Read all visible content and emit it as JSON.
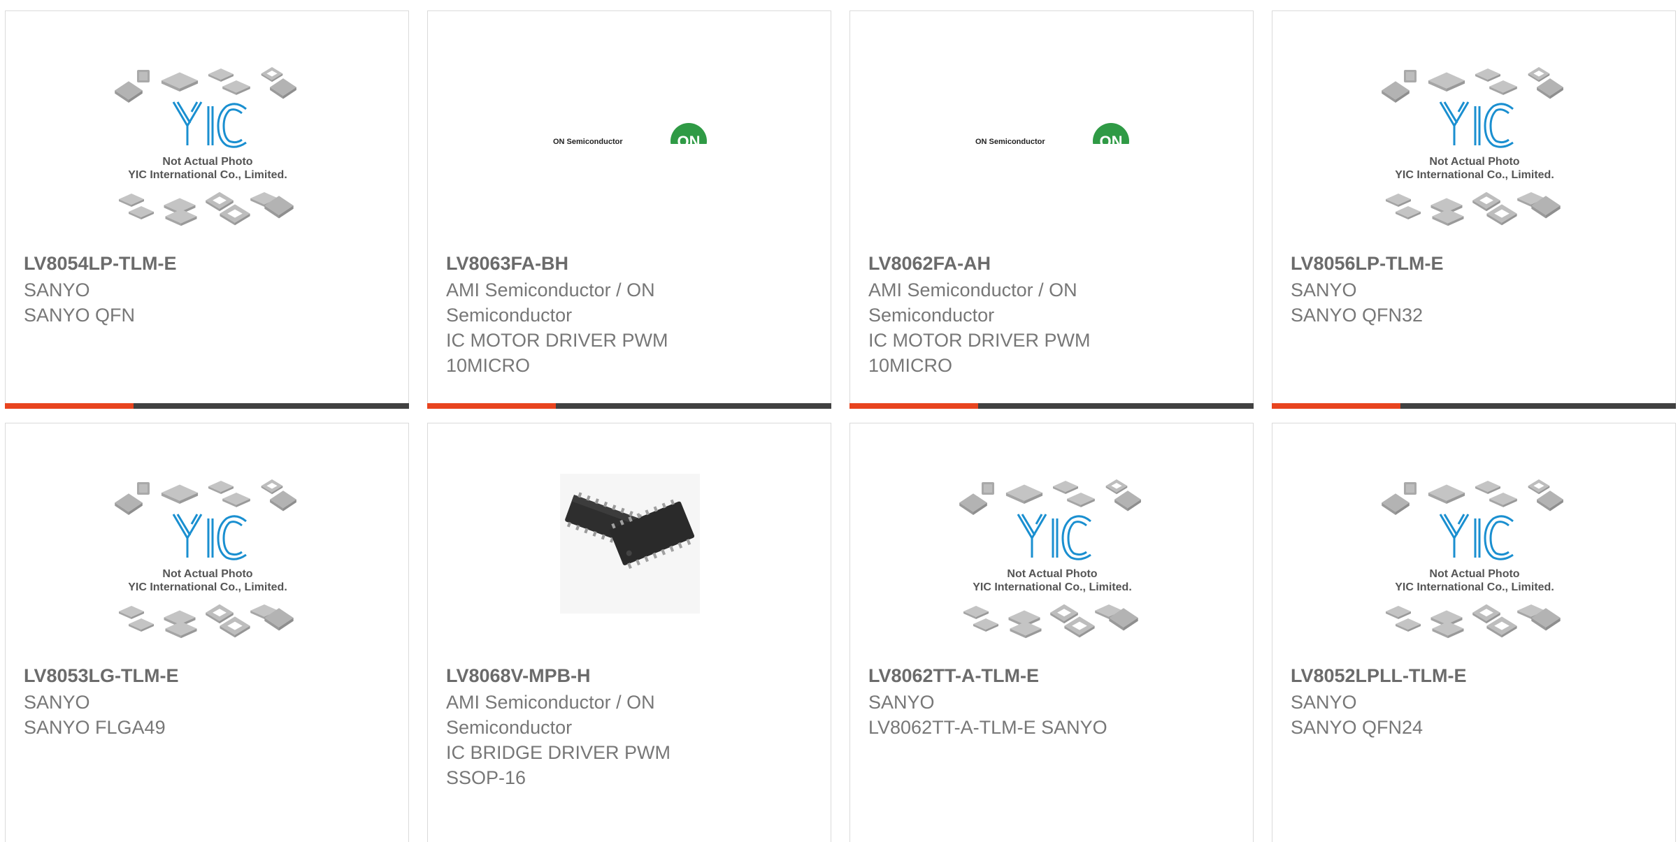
{
  "colors": {
    "accent_bar": "#e8441f",
    "dark_bar": "#414141",
    "yic_blue": "#1a8fd0",
    "on_green": "#2f9a45",
    "chip_gray": "#b9b9b9"
  },
  "placeholder": {
    "brand": "YIC",
    "line1": "Not Actual Photo",
    "line2": "YIC International Co., Limited."
  },
  "on_logo": {
    "wordmark": "ON Semiconductor",
    "badge": "ON"
  },
  "products": [
    {
      "part_number": "LV8054LP-TLM-E",
      "manufacturer": "SANYO",
      "description": "SANYO QFN",
      "image": "yic-placeholder"
    },
    {
      "part_number": "LV8063FA-BH",
      "manufacturer_line1": "AMI Semiconductor / ON",
      "manufacturer_line2": "Semiconductor",
      "description_line1": "IC MOTOR DRIVER PWM",
      "description_line2": "10MICRO",
      "image": "on-semiconductor-logo"
    },
    {
      "part_number": "LV8062FA-AH",
      "manufacturer_line1": "AMI Semiconductor / ON",
      "manufacturer_line2": "Semiconductor",
      "description_line1": "IC MOTOR DRIVER PWM",
      "description_line2": "10MICRO",
      "image": "on-semiconductor-logo"
    },
    {
      "part_number": "LV8056LP-TLM-E",
      "manufacturer": "SANYO",
      "description": "SANYO QFN32",
      "image": "yic-placeholder"
    },
    {
      "part_number": "LV8053LG-TLM-E",
      "manufacturer": "SANYO",
      "description": "SANYO FLGA49",
      "image": "yic-placeholder"
    },
    {
      "part_number": "LV8068V-MPB-H",
      "manufacturer_line1": "AMI Semiconductor / ON",
      "manufacturer_line2": "Semiconductor",
      "description_line1": "IC BRIDGE DRIVER PWM",
      "description_line2": "SSOP-16",
      "image": "ssop16-chip-photo"
    },
    {
      "part_number": "LV8062TT-A-TLM-E",
      "manufacturer": "SANYO",
      "description": "LV8062TT-A-TLM-E SANYO",
      "image": "yic-placeholder"
    },
    {
      "part_number": "LV8052LPLL-TLM-E",
      "manufacturer": "SANYO",
      "description": "SANYO QFN24",
      "image": "yic-placeholder"
    }
  ]
}
